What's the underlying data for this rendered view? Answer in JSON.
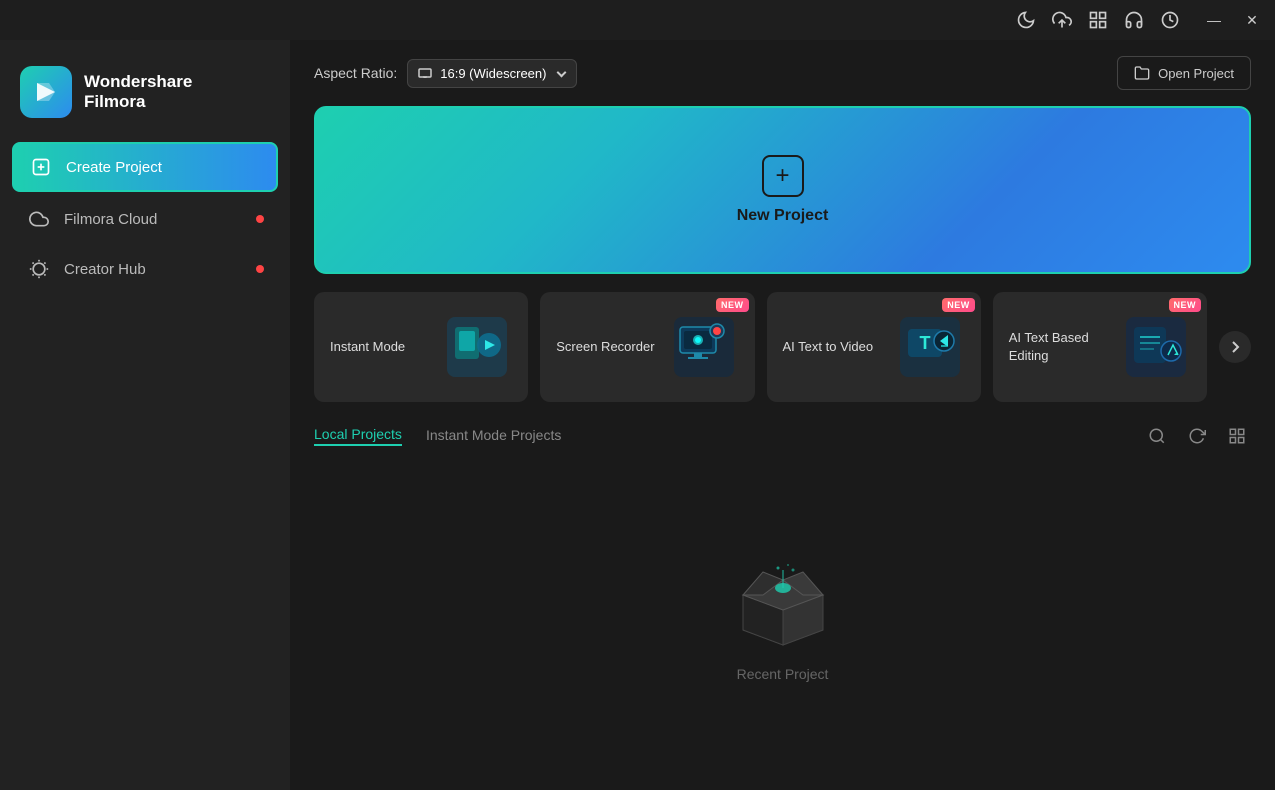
{
  "titlebar": {
    "icons": [
      "moon-icon",
      "upload-icon",
      "grid-icon",
      "headset-icon",
      "timer-icon"
    ],
    "min_label": "—",
    "close_label": "✕"
  },
  "sidebar": {
    "logo": {
      "name_line1": "Wondershare",
      "name_line2": "Filmora"
    },
    "items": [
      {
        "id": "create-project",
        "label": "Create Project",
        "icon": "plus-square-icon",
        "active": true,
        "badge": false
      },
      {
        "id": "filmora-cloud",
        "label": "Filmora Cloud",
        "icon": "cloud-icon",
        "active": false,
        "badge": true
      },
      {
        "id": "creator-hub",
        "label": "Creator Hub",
        "icon": "lightbulb-icon",
        "active": false,
        "badge": true
      }
    ]
  },
  "topbar": {
    "aspect_ratio_label": "Aspect Ratio:",
    "aspect_ratio_value": "16:9 (Widescreen)",
    "open_project_label": "Open Project"
  },
  "new_project": {
    "label": "New Project"
  },
  "feature_cards": [
    {
      "id": "instant-mode",
      "label": "Instant Mode",
      "badge": false,
      "emoji": "🎬"
    },
    {
      "id": "screen-recorder",
      "label": "Screen Recorder",
      "badge": true,
      "emoji": "🖥️"
    },
    {
      "id": "ai-text-to-video",
      "label": "AI Text to Video",
      "badge": true,
      "emoji": "🅣"
    },
    {
      "id": "ai-text-based-editing",
      "label": "AI Text Based Editing",
      "badge": true,
      "emoji": "✏️"
    }
  ],
  "projects": {
    "tabs": [
      {
        "id": "local",
        "label": "Local Projects",
        "active": true
      },
      {
        "id": "instant",
        "label": "Instant Mode Projects",
        "active": false
      }
    ],
    "empty_state": {
      "text": "Recent Project"
    }
  }
}
